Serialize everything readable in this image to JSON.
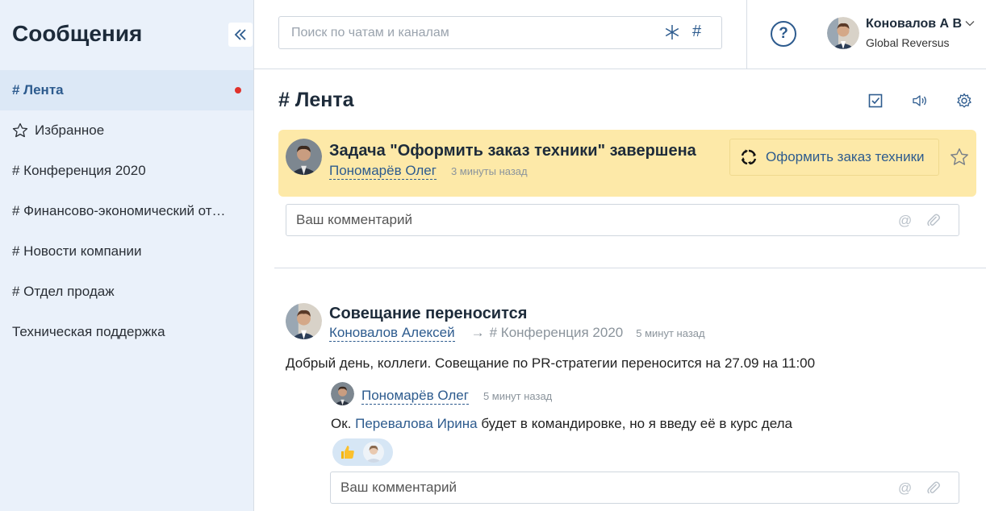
{
  "sidebar": {
    "title": "Сообщения",
    "items": [
      {
        "label": "# Лента"
      },
      {
        "label": "Избранное"
      },
      {
        "label": "# Конференция 2020"
      },
      {
        "label": "# Финансово-экономический от…"
      },
      {
        "label": "# Новости компании"
      },
      {
        "label": "# Отдел продаж"
      },
      {
        "label": "Техническая поддержка"
      }
    ]
  },
  "header": {
    "search_placeholder": "Поиск по чатам и каналам",
    "hash_symbol": "#",
    "help_symbol": "?",
    "user_name": "Коновалов А В",
    "user_org": "Global Reversus"
  },
  "main": {
    "title": "# Лента",
    "task_card": {
      "title": "Задача \"Оформить заказ техники\" завершена",
      "author": "Пономарёв Олег",
      "time": "3 минуты назад",
      "link_label": "Оформить заказ техники"
    },
    "comment_placeholder": "Ваш комментарий",
    "post": {
      "title": "Совещание переносится",
      "author": "Коновалов Алексей",
      "arrow": "→",
      "channel": "# Конференция 2020",
      "time": "5 минут назад",
      "text": "Добрый день, коллеги. Совещание по PR-стратегии переносится на 27.09 на 11:00"
    },
    "reply": {
      "author": "Пономарёв Олег",
      "time": "5 минут назад",
      "text_prefix": "Ок. ",
      "mention": "Перевалова Ирина",
      "text_suffix": " будет в командировке, но я введу её в курс дела"
    }
  },
  "colors": {
    "accent": "#2d5b8e",
    "sidebar_bg": "#eaf1fa",
    "highlight_bg": "#fde9a8",
    "unread_dot": "#e0322b"
  }
}
